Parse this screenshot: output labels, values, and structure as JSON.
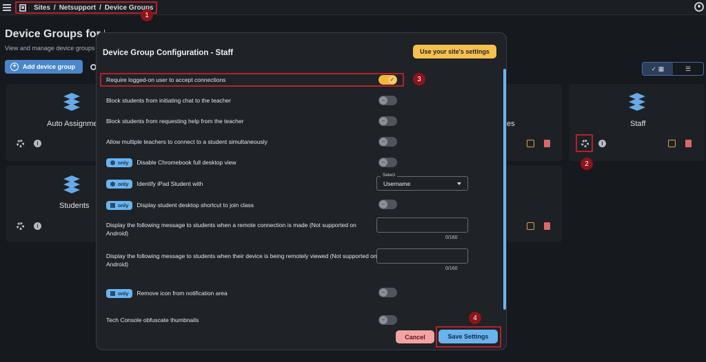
{
  "topbar": {
    "breadcrumbs": [
      "Sites",
      "/",
      "Netsupport",
      "/",
      "Device Groups"
    ]
  },
  "markers": [
    "1",
    "2",
    "3",
    "4"
  ],
  "page": {
    "title": "Device Groups for Netsupport",
    "subtitle": "View and manage device groups",
    "add_button": "Add device group",
    "view_icons": [
      "check-icon",
      "grid-icon",
      "list-icon"
    ]
  },
  "cards": [
    {
      "name": "Auto Assignments"
    },
    {
      "name": "es"
    },
    {
      "name": "Staff"
    },
    {
      "name": "Students"
    }
  ],
  "modal": {
    "title": "Device Group Configuration - Staff",
    "site_settings_button": "Use your site's settings",
    "rows": [
      {
        "label": "Require logged-on user to accept connections",
        "on": true
      },
      {
        "label": "Block students from initiating chat to the teacher",
        "on": false
      },
      {
        "label": "Block students from requesting help from the teacher",
        "on": false
      },
      {
        "label": "Allow multiple teachers to connect to a student simultaneously",
        "on": false
      },
      {
        "label": "Disable Chromebook full desktop view",
        "pill": "only",
        "on": false
      },
      {
        "label": "Identify iPad Student with",
        "pill": "only"
      },
      {
        "label": "Display student desktop shortcut to join class",
        "pill": "only",
        "on": false
      },
      {
        "label": "Display the following message to students when a remote connection is made (Not supported on Android)",
        "counter": "0/160"
      },
      {
        "label": "Display the following message to students when their device is being remotely viewed (Not supported on Android)",
        "counter": "0/160"
      },
      {
        "label": "Remove icon from notification area",
        "pill": "only",
        "on": false
      },
      {
        "label": "Tech Console obfuscate thumbnails",
        "on": false
      }
    ],
    "select": {
      "label": "Select",
      "value": "Username"
    },
    "cancel_button": "Cancel",
    "save_button": "Save Settings"
  }
}
